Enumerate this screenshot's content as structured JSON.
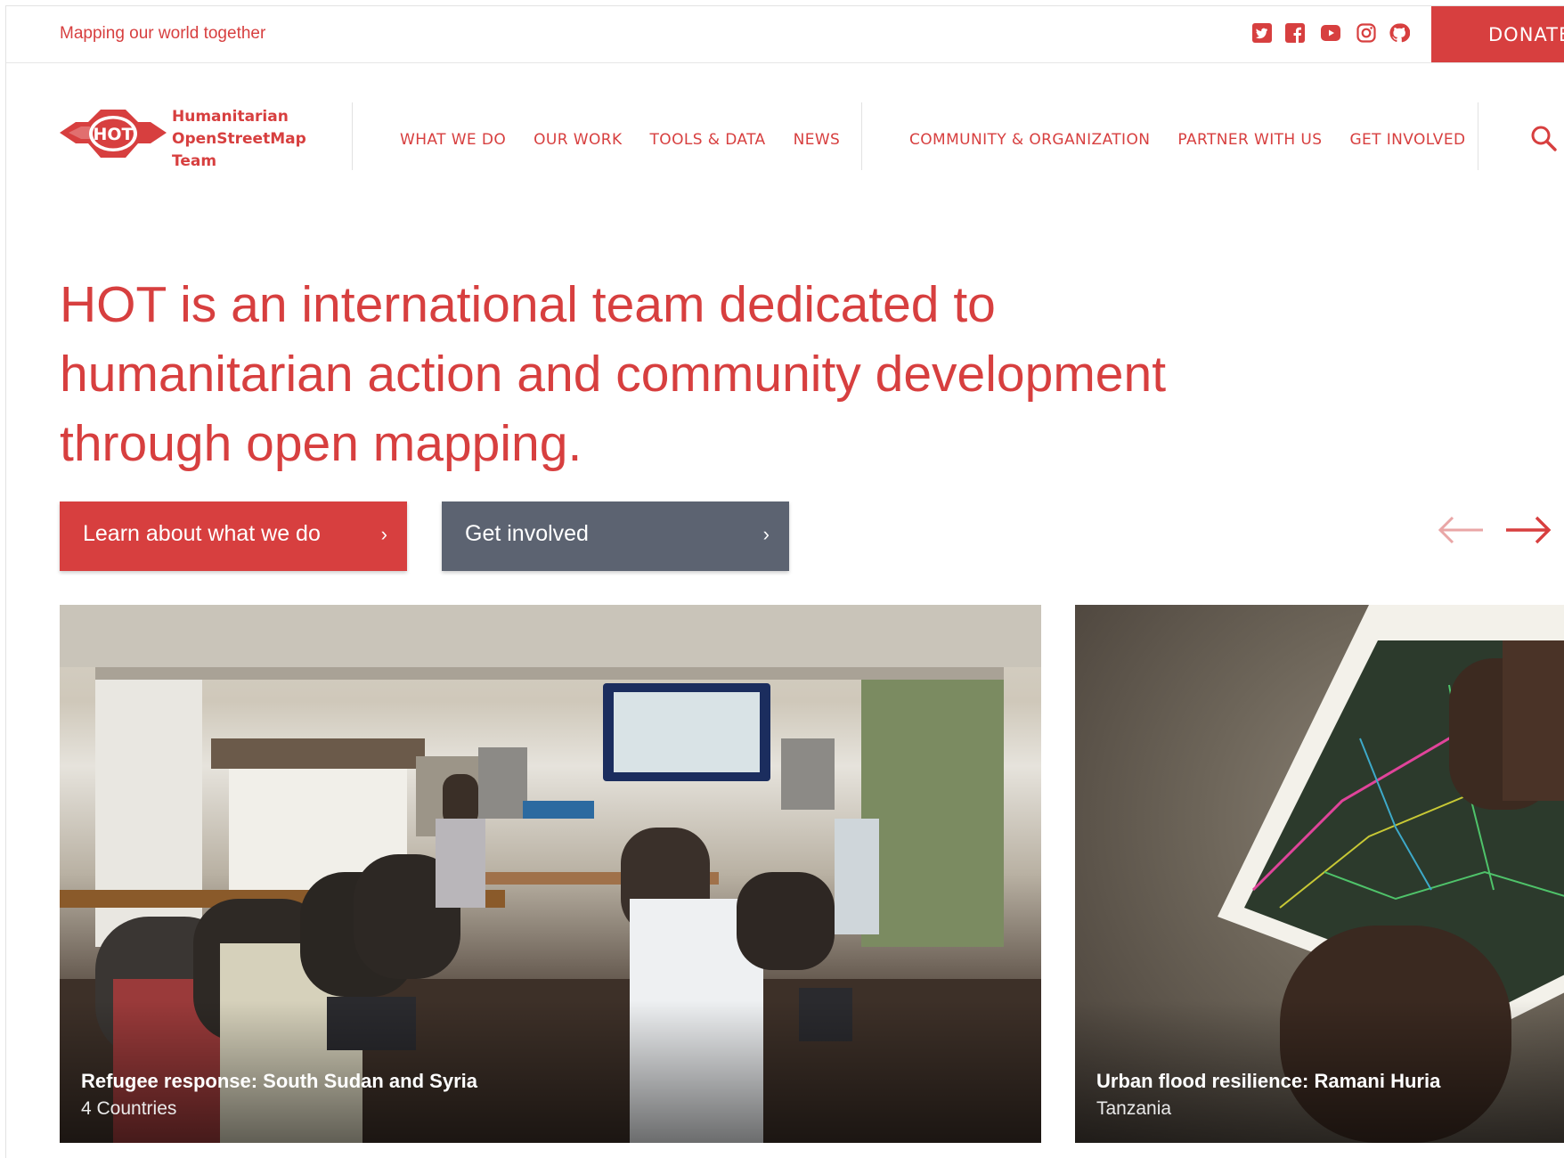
{
  "topbar": {
    "tagline": "Mapping our world together",
    "social_icons": [
      "twitter-icon",
      "facebook-icon",
      "youtube-icon",
      "instagram-icon",
      "github-icon"
    ],
    "donate_label": "DONATE"
  },
  "header": {
    "logo_badge": "HOT",
    "logo_lines": [
      "Humanitarian",
      "OpenStreetMap",
      "Team"
    ],
    "nav_primary": [
      "WHAT WE DO",
      "OUR WORK",
      "TOOLS & DATA",
      "NEWS"
    ],
    "nav_secondary": [
      "COMMUNITY & ORGANIZATION",
      "PARTNER WITH US",
      "GET INVOLVED"
    ],
    "search_icon": "search-icon"
  },
  "hero": {
    "title": "HOT is an international team dedicated to humanitarian action and community development through open mapping.",
    "buttons": [
      {
        "label": "Learn about what we do",
        "chevron": "›"
      },
      {
        "label": "Get involved",
        "chevron": "›"
      }
    ]
  },
  "carousel": {
    "prev_icon": "arrow-left-icon",
    "next_icon": "arrow-right-icon",
    "cards": [
      {
        "title": "Refugee response: South Sudan and Syria",
        "subtitle": "4 Countries"
      },
      {
        "title": "Urban flood resilience: Ramani Huria",
        "subtitle": "Tanzania"
      }
    ]
  },
  "colors": {
    "brand_red": "#d73f3f",
    "button_gray": "#5c6371"
  }
}
